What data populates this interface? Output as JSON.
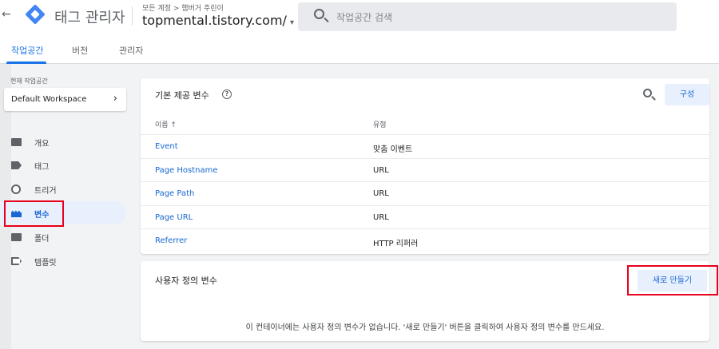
{
  "header": {
    "back_glyph": "←",
    "app_title": "태그 관리자",
    "account_crumb": "모든 계정 > 햄버거 주린이",
    "container_name": "topmental.tistory.com/",
    "container_caret": "▾",
    "search_placeholder": "작업공간 검색"
  },
  "tabs": [
    {
      "label": "작업공간",
      "active": true
    },
    {
      "label": "버전",
      "active": false
    },
    {
      "label": "관리자",
      "active": false
    }
  ],
  "sidebar": {
    "current_workspace_label": "현재 작업공간",
    "workspace_name": "Default Workspace",
    "workspace_chevron": "›",
    "items": [
      {
        "label": "개요",
        "icon": "overview-icon"
      },
      {
        "label": "태그",
        "icon": "tag-icon"
      },
      {
        "label": "트리거",
        "icon": "trigger-icon"
      },
      {
        "label": "변수",
        "icon": "variables-icon",
        "active": true
      },
      {
        "label": "폴더",
        "icon": "folder-icon"
      },
      {
        "label": "템플릿",
        "icon": "template-icon"
      }
    ]
  },
  "builtin_card": {
    "title": "기본 제공 변수",
    "help_glyph": "?",
    "configure_label": "구성",
    "col_name": "이름 ↑",
    "col_type": "유형",
    "rows": [
      {
        "name": "Event",
        "type": "맞춤 이벤트"
      },
      {
        "name": "Page Hostname",
        "type": "URL"
      },
      {
        "name": "Page Path",
        "type": "URL"
      },
      {
        "name": "Page URL",
        "type": "URL"
      },
      {
        "name": "Referrer",
        "type": "HTTP 리퍼러"
      }
    ]
  },
  "user_card": {
    "title": "사용자 정의 변수",
    "new_label": "새로 만들기",
    "empty_message": "이 컨테이너에는 사용자 정의 변수가 없습니다. '새로 만들기' 버튼을 클릭하여 사용자 정의 변수를 만드세요."
  },
  "colors": {
    "accent": "#1a73e8",
    "highlight_box": "#e8001c"
  }
}
